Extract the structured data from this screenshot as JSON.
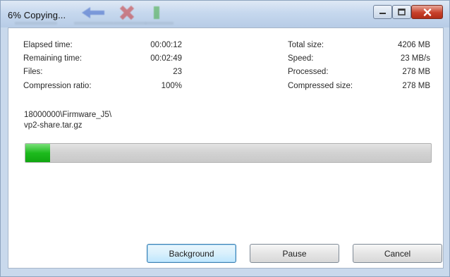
{
  "window": {
    "title": "6% Copying..."
  },
  "stats_left": [
    {
      "label": "Elapsed time:",
      "value": "00:00:12"
    },
    {
      "label": "Remaining time:",
      "value": "00:02:49"
    },
    {
      "label": "Files:",
      "value": "23"
    },
    {
      "label": "Compression ratio:",
      "value": "100%"
    }
  ],
  "stats_right": [
    {
      "label": "Total size:",
      "value": "4206 MB"
    },
    {
      "label": "Speed:",
      "value": "23 MB/s"
    },
    {
      "label": "Processed:",
      "value": "278 MB"
    },
    {
      "label": "Compressed size:",
      "value": "278 MB"
    }
  ],
  "current_file": {
    "line1": "18000000\\Firmware_J5\\",
    "line2": "vp2-share.tar.gz"
  },
  "progress": {
    "percent": 6,
    "fill_color": "#1dbb1d"
  },
  "buttons": {
    "background": "Background",
    "pause": "Pause",
    "cancel": "Cancel"
  },
  "icons": {
    "minimize": "minimize-icon",
    "maximize": "maximize-icon",
    "close": "close-icon"
  }
}
